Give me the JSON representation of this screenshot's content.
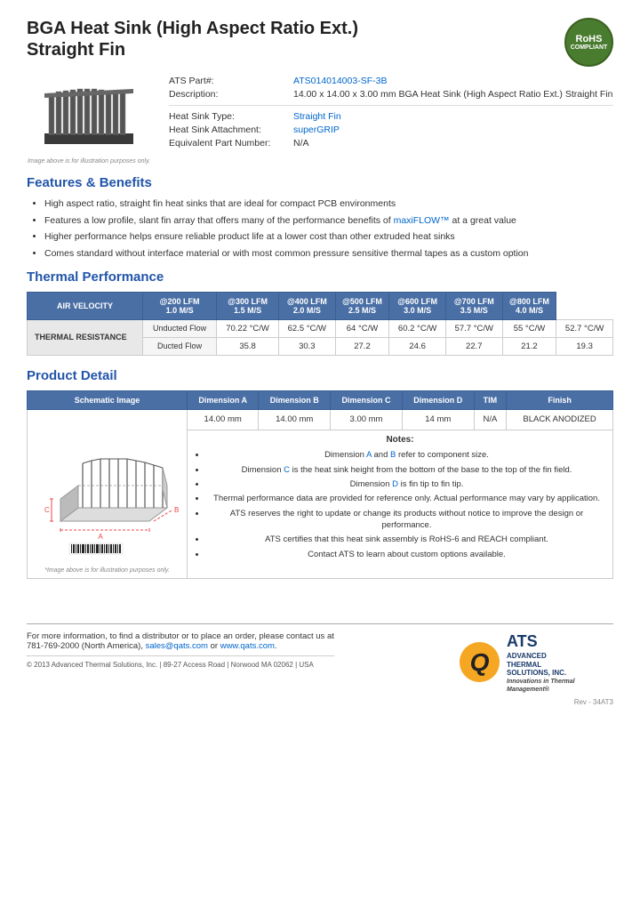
{
  "page": {
    "title_line1": "BGA Heat Sink (High Aspect Ratio Ext.)",
    "title_line2": "Straight Fin"
  },
  "rohs": {
    "label": "RoHS",
    "sublabel": "COMPLIANT"
  },
  "specs": {
    "part_label": "ATS Part#:",
    "part_value": "ATS014014003-SF-3B",
    "desc_label": "Description:",
    "desc_value": "14.00 x 14.00 x 3.00 mm  BGA Heat Sink (High Aspect Ratio Ext.) Straight Fin",
    "type_label": "Heat Sink Type:",
    "type_value": "Straight Fin",
    "attachment_label": "Heat Sink Attachment:",
    "attachment_value": "superGRIP",
    "equiv_label": "Equivalent Part Number:",
    "equiv_value": "N/A"
  },
  "image_caption": "Image above is for illustration purposes only.",
  "sections": {
    "features_title": "Features & Benefits",
    "thermal_title": "Thermal Performance",
    "detail_title": "Product Detail"
  },
  "features": [
    "High aspect ratio, straight fin heat sinks that are ideal for compact PCB environments",
    "Features a low profile, slant fin array that offers many of the performance benefits of maxiFLOW™ at a great value",
    "Higher performance helps ensure reliable product life at a lower cost than other extruded heat sinks",
    "Comes standard without interface material or with most common pressure sensitive thermal tapes as a custom option"
  ],
  "thermal_table": {
    "headers": {
      "col1": "AIR VELOCITY",
      "col2": "@200 LFM\n1.0 M/S",
      "col3": "@300 LFM\n1.5 M/S",
      "col4": "@400 LFM\n2.0 M/S",
      "col5": "@500 LFM\n2.5 M/S",
      "col6": "@600 LFM\n3.0 M/S",
      "col7": "@700 LFM\n3.5 M/S",
      "col8": "@800 LFM\n4.0 M/S"
    },
    "row_label": "THERMAL RESISTANCE",
    "rows": [
      {
        "label": "Unducted Flow",
        "values": [
          "70.22 °C/W",
          "62.5 °C/W",
          "64 °C/W",
          "60.2 °C/W",
          "57.7 °C/W",
          "55 °C/W",
          "52.7 °C/W"
        ]
      },
      {
        "label": "Ducted Flow",
        "values": [
          "35.8",
          "30.3",
          "27.2",
          "24.6",
          "22.7",
          "21.2",
          "19.3"
        ]
      }
    ]
  },
  "product_detail": {
    "schematic_header": "Schematic Image",
    "dim_a_header": "Dimension A",
    "dim_b_header": "Dimension B",
    "dim_c_header": "Dimension C",
    "dim_d_header": "Dimension D",
    "tim_header": "TIM",
    "finish_header": "Finish",
    "dim_a": "14.00 mm",
    "dim_b": "14.00 mm",
    "dim_c": "3.00 mm",
    "dim_d": "14 mm",
    "tim": "N/A",
    "finish": "BLACK ANODIZED",
    "schematic_caption": "*Image above is for illustration purposes only."
  },
  "notes": {
    "title": "Notes:",
    "items": [
      "Dimension A and B refer to component size.",
      "Dimension C is the heat sink height from the bottom of the base to the top of the fin field.",
      "Dimension D is fin tip to fin tip.",
      "Thermal performance data are provided for reference only. Actual performance may vary by application.",
      "ATS reserves the right to update or change its products without notice to improve the design or performance.",
      "ATS certifies that this heat sink assembly is RoHS-6 and REACH compliant.",
      "Contact ATS to learn about custom options available."
    ]
  },
  "footer": {
    "contact_text": "For more information, to find a distributor or to place an order, please contact us at\n781-769-2000 (North America),",
    "email": "sales@qats.com",
    "or_text": "or",
    "website": "www.qats.com",
    "copyright": "© 2013 Advanced Thermal Solutions, Inc.  |  89-27 Access Road  |  Norwood MA  02062  |  USA",
    "ats_name_big": "ATS",
    "ats_name_full": "ADVANCED\nTHERMAL\nSOLUTIONS, INC.",
    "ats_tagline": "Innovations in Thermal Management®",
    "page_number": "Rev - 34AT3"
  }
}
